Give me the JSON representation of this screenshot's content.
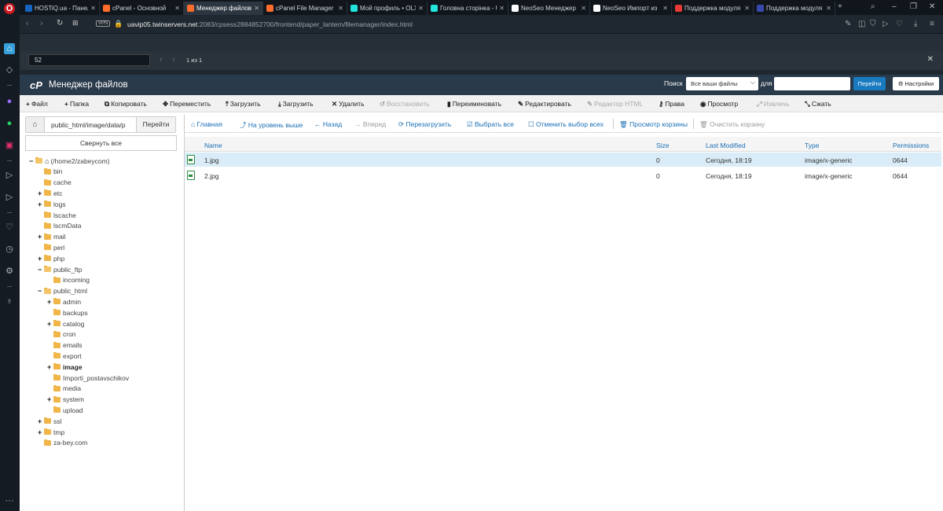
{
  "browser": {
    "tabs": [
      {
        "title": "HOSTiQ.ua - Панель",
        "fav_color": "#1565c0",
        "active": false
      },
      {
        "title": "cPanel - Основной",
        "fav_color": "#ff6c2c",
        "active": false
      },
      {
        "title": "Менеджер файлов",
        "fav_color": "#ff6c2c",
        "active": true
      },
      {
        "title": "cPanel File Manager",
        "fav_color": "#ff6c2c",
        "active": false
      },
      {
        "title": "Мой профиль • OLX",
        "fav_color": "#23e5db",
        "active": false
      },
      {
        "title": "Головна сторінка - U",
        "fav_color": "#23e5db",
        "active": false
      },
      {
        "title": "NeoSeo Менеджер",
        "fav_color": "#ffffff",
        "active": false
      },
      {
        "title": "NeoSeo Импорт из",
        "fav_color": "#ffffff",
        "active": false
      },
      {
        "title": "Поддержка модуля",
        "fav_color": "#e53935",
        "active": false
      },
      {
        "title": "Поддержка модуля",
        "fav_color": "#3949ab",
        "active": false
      }
    ],
    "vpn_label": "VPN",
    "url_host": "uavip05.twinservers.net",
    "url_rest": ":2083/cpsess2884852700/frontend/paper_lantern/filemanager/index.html",
    "find": {
      "query": "52",
      "count": "1 из 1"
    }
  },
  "header": {
    "title": "Менеджер файлов",
    "logo": "cP",
    "search_label": "Поиск",
    "search_scope": "Все ваши файлы",
    "for_label": "для",
    "go_label": "Перейти",
    "settings_label": "Настройки"
  },
  "toolbar": [
    {
      "label": "Файл",
      "icon": "+",
      "enabled": true
    },
    {
      "label": "Папка",
      "icon": "+",
      "enabled": true
    },
    {
      "label": "Копировать",
      "icon": "⧉",
      "enabled": true
    },
    {
      "label": "Переместить",
      "icon": "✥",
      "enabled": true
    },
    {
      "label": "Загрузить",
      "icon": "⤒",
      "enabled": true
    },
    {
      "label": "Загрузить",
      "icon": "⤓",
      "enabled": true
    },
    {
      "label": "Удалить",
      "icon": "✕",
      "enabled": true
    },
    {
      "label": "Восстановить",
      "icon": "↺",
      "enabled": false
    },
    {
      "label": "Переименовать",
      "icon": "▮",
      "enabled": true
    },
    {
      "label": "Редактировать",
      "icon": "✎",
      "enabled": true
    },
    {
      "label": "Редактор HTML",
      "icon": "✎",
      "enabled": false
    },
    {
      "label": "Права",
      "icon": "⚷",
      "enabled": true
    },
    {
      "label": "Просмотр",
      "icon": "◉",
      "enabled": true
    },
    {
      "label": "Извлечь",
      "icon": "⤢",
      "enabled": false
    },
    {
      "label": "Сжать",
      "icon": "⤡",
      "enabled": true
    }
  ],
  "pathbar": {
    "path": "public_html/image/data/p",
    "go_label": "Перейти"
  },
  "collapse_label": "Свернуть все",
  "tree": [
    {
      "label": "(/home2/zabeycom)",
      "depth": 0,
      "toggle": "−",
      "open": true,
      "home": true,
      "bold": false
    },
    {
      "label": "bin",
      "depth": 1,
      "toggle": "",
      "open": false,
      "bold": false
    },
    {
      "label": "cache",
      "depth": 1,
      "toggle": "",
      "open": false,
      "bold": false
    },
    {
      "label": "etc",
      "depth": 1,
      "toggle": "+",
      "open": false,
      "bold": false
    },
    {
      "label": "logs",
      "depth": 1,
      "toggle": "+",
      "open": false,
      "bold": false
    },
    {
      "label": "lscache",
      "depth": 1,
      "toggle": "",
      "open": false,
      "bold": false
    },
    {
      "label": "lscmData",
      "depth": 1,
      "toggle": "",
      "open": false,
      "bold": false
    },
    {
      "label": "mail",
      "depth": 1,
      "toggle": "+",
      "open": false,
      "bold": false
    },
    {
      "label": "perl",
      "depth": 1,
      "toggle": "",
      "open": false,
      "bold": false
    },
    {
      "label": "php",
      "depth": 1,
      "toggle": "+",
      "open": false,
      "bold": false
    },
    {
      "label": "public_ftp",
      "depth": 1,
      "toggle": "−",
      "open": true,
      "bold": false
    },
    {
      "label": "incoming",
      "depth": 2,
      "toggle": "",
      "open": false,
      "bold": false
    },
    {
      "label": "public_html",
      "depth": 1,
      "toggle": "−",
      "open": true,
      "bold": false
    },
    {
      "label": "admin",
      "depth": 2,
      "toggle": "+",
      "open": false,
      "bold": false
    },
    {
      "label": "backups",
      "depth": 2,
      "toggle": "",
      "open": false,
      "bold": false
    },
    {
      "label": "catalog",
      "depth": 2,
      "toggle": "+",
      "open": false,
      "bold": false
    },
    {
      "label": "cron",
      "depth": 2,
      "toggle": "",
      "open": false,
      "bold": false
    },
    {
      "label": "emails",
      "depth": 2,
      "toggle": "",
      "open": false,
      "bold": false
    },
    {
      "label": "export",
      "depth": 2,
      "toggle": "",
      "open": false,
      "bold": false
    },
    {
      "label": "image",
      "depth": 2,
      "toggle": "+",
      "open": false,
      "bold": true
    },
    {
      "label": "Importi_postavschikov",
      "depth": 2,
      "toggle": "",
      "open": false,
      "bold": false
    },
    {
      "label": "media",
      "depth": 2,
      "toggle": "",
      "open": false,
      "bold": false
    },
    {
      "label": "system",
      "depth": 2,
      "toggle": "+",
      "open": false,
      "bold": false
    },
    {
      "label": "upload",
      "depth": 2,
      "toggle": "",
      "open": false,
      "bold": false
    },
    {
      "label": "ssl",
      "depth": 1,
      "toggle": "+",
      "open": false,
      "bold": false
    },
    {
      "label": "tmp",
      "depth": 1,
      "toggle": "+",
      "open": false,
      "bold": false
    },
    {
      "label": "za-bey.com",
      "depth": 1,
      "toggle": "",
      "open": false,
      "bold": false
    }
  ],
  "panel_toolbar": [
    {
      "label": "Главная",
      "icon": "⌂",
      "enabled": true
    },
    {
      "label": "На уровень выше",
      "icon": "⤴",
      "enabled": true
    },
    {
      "label": "Назад",
      "icon": "←",
      "enabled": true
    },
    {
      "label": "Вперед",
      "icon": "→",
      "enabled": false
    },
    {
      "label": "Перезагрузить",
      "icon": "⟳",
      "enabled": true
    },
    {
      "label": "Выбрать все",
      "icon": "☑",
      "enabled": true
    },
    {
      "label": "Отменить выбор всех",
      "icon": "☐",
      "enabled": true
    },
    {
      "label": "Просмотр корзины",
      "icon": "🗑",
      "enabled": true
    },
    {
      "label": "Очистить корзину",
      "icon": "🗑",
      "enabled": false
    }
  ],
  "columns": [
    "Name",
    "Size",
    "Last Modified",
    "Type",
    "Permissions"
  ],
  "files": [
    {
      "name": "1.jpg",
      "size": "0",
      "modified": "Сегодня, 18:19",
      "type": "image/x-generic",
      "perms": "0644",
      "selected": true
    },
    {
      "name": "2.jpg",
      "size": "0",
      "modified": "Сегодня, 18:19",
      "type": "image/x-generic",
      "perms": "0644",
      "selected": false
    }
  ]
}
